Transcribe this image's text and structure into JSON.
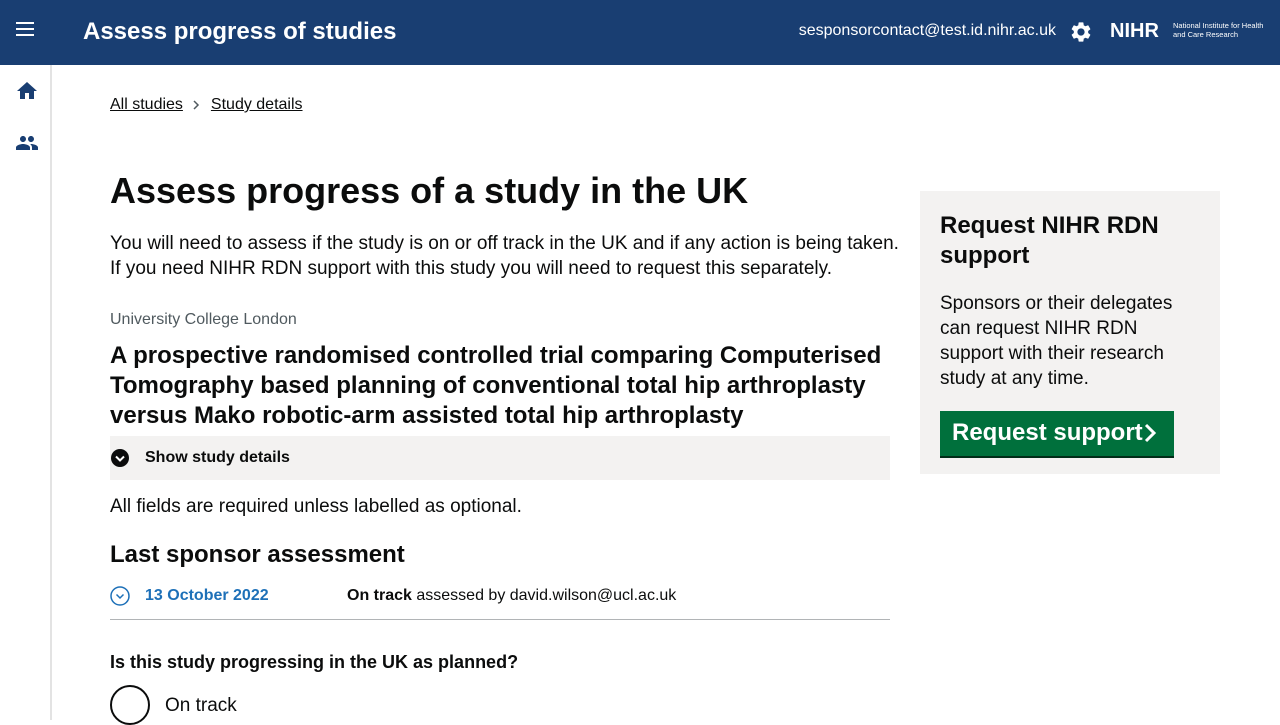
{
  "header": {
    "title": "Assess progress of studies",
    "user_email": "sesponsorcontact@test.id.nihr.ac.uk",
    "logo_main": "NIHR",
    "logo_sub": "National Institute for Health and Care Research",
    "background_color": "#193e72"
  },
  "sidebar": {
    "items": [
      {
        "icon": "home-icon"
      },
      {
        "icon": "users-icon"
      }
    ]
  },
  "breadcrumb": {
    "items": [
      "All studies",
      "Study details"
    ]
  },
  "page": {
    "title": "Assess progress of a study in the UK",
    "intro": "You will need to assess if the study is on or off track in the UK and if any action is being taken. If you need NIHR RDN support with this study you will need to request this separately.",
    "sponsor_org": "University College London",
    "study_title": "A prospective randomised controlled trial comparing Computerised Tomography based planning of conventional total hip arthroplasty versus Mako robotic-arm assisted total hip arthroplasty",
    "show_details_label": "Show study details",
    "required_note": "All fields are required unless labelled as optional.",
    "last_assessment_heading": "Last sponsor assessment"
  },
  "last_assessment": {
    "date": "13 October 2022",
    "status": "On track",
    "assessed_by_text": "assessed by david.wilson@ucl.ac.uk"
  },
  "question": {
    "label": "Is this study progressing in the UK as planned?",
    "options": [
      "On track"
    ]
  },
  "side_panel": {
    "title": "Request NIHR RDN support",
    "text": "Sponsors or their delegates can request NIHR RDN support with their research study at any time.",
    "button_label": "Request support",
    "button_color": "#00703c"
  }
}
